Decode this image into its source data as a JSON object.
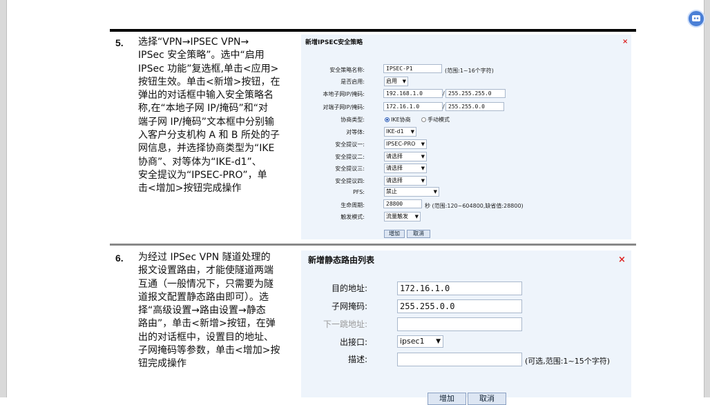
{
  "step5": {
    "number": "5.",
    "text": "选择“VPN→IPSEC VPN→\nIPSec 安全策略”。选中“启用\nIPSec 功能”复选框,单击<应用>\n按钮生效。单击<新增>按钮，在\n弹出的对话框中输入安全策略名\n称,在“本地子网 IP/掩码”和“对\n端子网 IP/掩码”文本框中分别输\n入客户分支机构 A 和 B 所处的子\n网信息，并选择协商类型为“IKE\n协商”、对等体为“IKE-d1”、\n安全提议为“IPSEC-PRO”，单\n击<增加>按钮完成操作"
  },
  "dialog1": {
    "title": "新增IPSEC安全策略",
    "close": "×",
    "policy_name_label": "安全策略名称:",
    "policy_name_value": "IPSEC-P1",
    "policy_name_hint": "(范围:1~16个字符)",
    "enable_label": "是否启用:",
    "enable_value": "启用",
    "local_label": "本地子网IP/掩码:",
    "local_ip": "192.168.1.0",
    "local_mask": "255.255.255.0",
    "remote_label": "对端子网IP/掩码:",
    "remote_ip": "172.16.1.0",
    "remote_mask": "255.255.0.0",
    "slash": "/",
    "nego_label": "协商类型:",
    "nego_ike": "IKE协商",
    "nego_manual": "手动模式",
    "peer_label": "对等体:",
    "peer_value": "IKE-d1",
    "prop1_label": "安全提议一:",
    "prop1_value": "IPSEC-PRO",
    "prop2_label": "安全提议二:",
    "prop2_value": "请选择",
    "prop3_label": "安全提议三:",
    "prop3_value": "请选择",
    "prop4_label": "安全提议四:",
    "prop4_value": "请选择",
    "pfs_label": "PFS:",
    "pfs_value": "禁止",
    "life_label": "生命周期:",
    "life_value": "28800",
    "life_hint": "秒 (范围:120~604800,缺省值:28800)",
    "trigger_label": "触发模式:",
    "trigger_value": "流量触发",
    "add_button": "增加",
    "cancel_button": "取消"
  },
  "step6": {
    "number": "6.",
    "text": "为经过 IPSec VPN 隧道处理的\n报文设置路由，才能使隧道两端\n互通（一般情况下，只需要为隧\n道报文配置静态路由即可）。选\n择“高级设置→路由设置→静态\n路由”，单击<新增>按钮，在弹\n出的对话框中，设置目的地址、\n子网掩码等参数，单击<增加>按\n钮完成操作"
  },
  "dialog2": {
    "title": "新增静态路由列表",
    "close": "×",
    "dest_label": "目的地址:",
    "dest_value": "172.16.1.0",
    "mask_label": "子网掩码:",
    "mask_value": "255.255.0.0",
    "nexthop_label": "下一跳地址:",
    "nexthop_value": "",
    "iface_label": "出接口:",
    "iface_value": "ipsec1",
    "desc_label": "描述:",
    "desc_value": "",
    "desc_hint": "(可选,范围:1~15个字符)",
    "add_button": "增加",
    "cancel_button": "取消"
  },
  "icons": {
    "fab": "app-icon"
  }
}
